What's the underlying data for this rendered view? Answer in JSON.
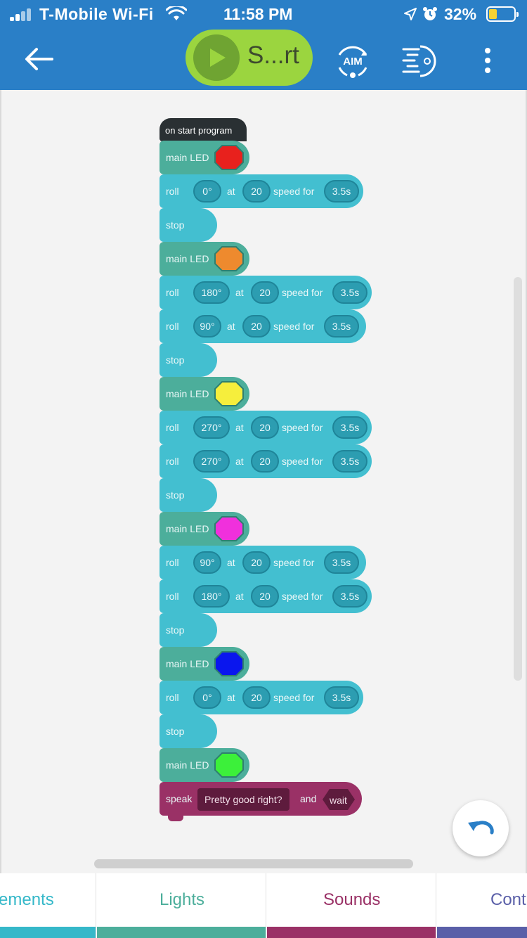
{
  "status_bar": {
    "carrier": "T-Mobile Wi-Fi",
    "time": "11:58 PM",
    "battery": "32%",
    "battery_color": "#f6d233"
  },
  "toolbar": {
    "back_icon": "back-arrow-icon",
    "start_label": "S...rt",
    "aim_label": "AIM",
    "drive_icon": "drive-icon",
    "more_icon": "more-vertical-icon",
    "bar_color": "#2a7fc7",
    "start_color": "#9bd53f"
  },
  "program": {
    "hat_label": "on start program",
    "led_label": "main LED",
    "roll_label": "roll",
    "at_label": "at",
    "speed_label": "speed for",
    "stop_label": "stop",
    "blocks": [
      {
        "type": "led",
        "color": "#e8211d"
      },
      {
        "type": "roll",
        "heading": "0°",
        "speed": "20",
        "duration": "3.5s"
      },
      {
        "type": "stop"
      },
      {
        "type": "led",
        "color": "#ee8a2e"
      },
      {
        "type": "roll",
        "heading": "180°",
        "speed": "20",
        "duration": "3.5s"
      },
      {
        "type": "roll",
        "heading": "90°",
        "speed": "20",
        "duration": "3.5s"
      },
      {
        "type": "stop"
      },
      {
        "type": "led",
        "color": "#f6ee3c"
      },
      {
        "type": "roll",
        "heading": "270°",
        "speed": "20",
        "duration": "3.5s"
      },
      {
        "type": "roll",
        "heading": "270°",
        "speed": "20",
        "duration": "3.5s"
      },
      {
        "type": "stop"
      },
      {
        "type": "led",
        "color": "#f030dc"
      },
      {
        "type": "roll",
        "heading": "90°",
        "speed": "20",
        "duration": "3.5s"
      },
      {
        "type": "roll",
        "heading": "180°",
        "speed": "20",
        "duration": "3.5s"
      },
      {
        "type": "stop"
      },
      {
        "type": "led",
        "color": "#0a16ee"
      },
      {
        "type": "roll",
        "heading": "0°",
        "speed": "20",
        "duration": "3.5s"
      },
      {
        "type": "stop"
      },
      {
        "type": "led",
        "color": "#3cf03a"
      },
      {
        "type": "speak",
        "label": "speak",
        "phrase": "Pretty good right?",
        "and_label": "and",
        "wait_label": "wait"
      }
    ]
  },
  "undo_icon": "undo-icon",
  "tabs": [
    {
      "label": "ements",
      "color": "#35b8c9"
    },
    {
      "label": "Lights",
      "color": "#4cae9b"
    },
    {
      "label": "Sounds",
      "color": "#9a3166"
    },
    {
      "label": "Cont",
      "color": "#5a5fa8"
    }
  ]
}
